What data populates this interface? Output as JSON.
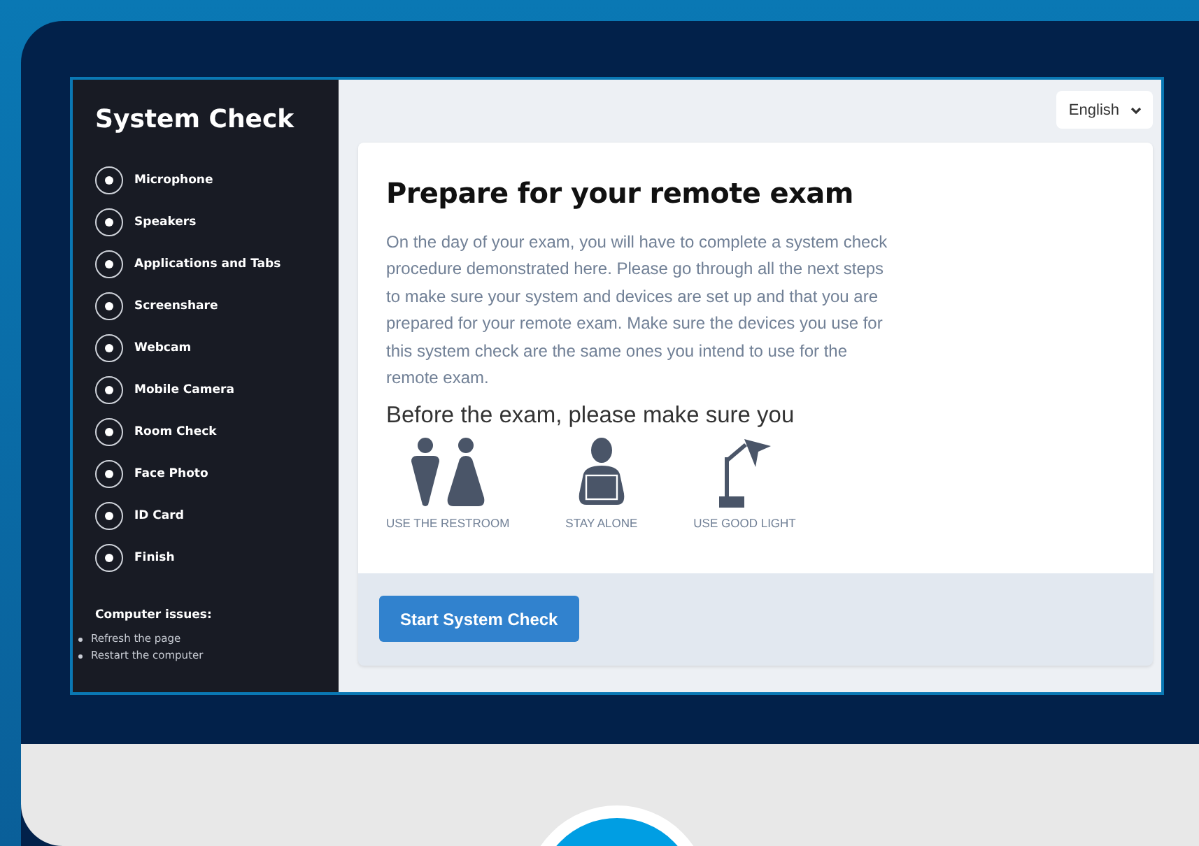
{
  "sidebar": {
    "title": "System Check",
    "steps": [
      {
        "label": "Microphone"
      },
      {
        "label": "Speakers"
      },
      {
        "label": "Applications and Tabs"
      },
      {
        "label": "Screenshare"
      },
      {
        "label": "Webcam"
      },
      {
        "label": "Mobile Camera"
      },
      {
        "label": "Room Check"
      },
      {
        "label": "Face Photo"
      },
      {
        "label": "ID Card"
      },
      {
        "label": "Finish"
      }
    ],
    "help": {
      "heading": "Computer issues:",
      "items": [
        "Refresh the page",
        "Restart the computer"
      ]
    }
  },
  "language": {
    "value": "English"
  },
  "card": {
    "heading": "Prepare for your remote exam",
    "paragraph": "On the day of your exam, you will have to complete a system check procedure demonstrated here. Please go through all the next steps to make sure your system and devices are set up and that you are prepared for your remote exam. Make sure the devices you use for this system check are the same ones you intend to use for the remote exam.",
    "subheading": "Before the exam, please make sure you",
    "requirements": [
      {
        "kind": "restroom",
        "label": "USE THE RESTROOM"
      },
      {
        "kind": "alone",
        "label": "STAY ALONE"
      },
      {
        "kind": "light",
        "label": "USE GOOD LIGHT"
      }
    ],
    "button": "Start System Check"
  }
}
